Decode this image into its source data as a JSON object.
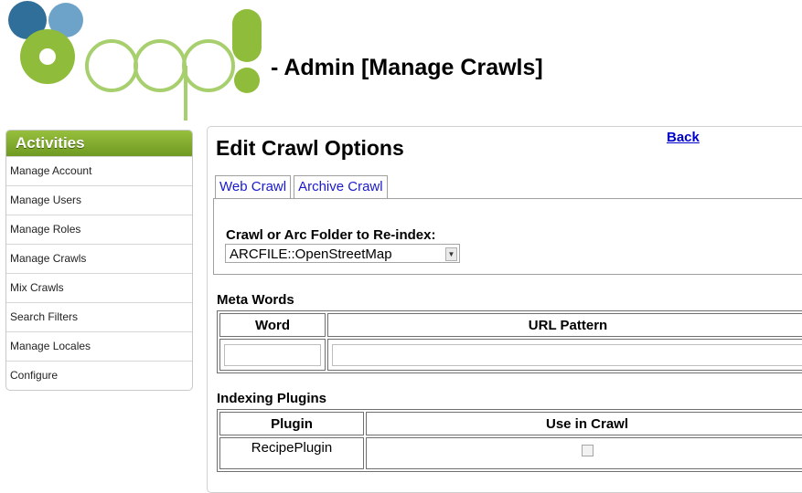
{
  "header": {
    "title": "- Admin [Manage Crawls]",
    "colors": {
      "logo_blue": "#2f6f9a",
      "logo_green": "#8fbc3a",
      "logo_outline": "#a8cf6e"
    }
  },
  "sidebar": {
    "title": "Activities",
    "items": [
      {
        "label": "Manage Account"
      },
      {
        "label": "Manage Users"
      },
      {
        "label": "Manage Roles"
      },
      {
        "label": "Manage Crawls"
      },
      {
        "label": "Mix Crawls"
      },
      {
        "label": "Search Filters"
      },
      {
        "label": "Manage Locales"
      },
      {
        "label": "Configure"
      }
    ]
  },
  "main": {
    "title": "Edit Crawl Options",
    "back_label": "Back",
    "tabs": [
      {
        "label": "Web Crawl"
      },
      {
        "label": "Archive Crawl"
      }
    ],
    "archive": {
      "folder_label": "Crawl or Arc Folder to Re-index:",
      "folder_value": "ARCFILE::OpenStreetMap"
    },
    "meta_words": {
      "title": "Meta Words",
      "columns": [
        "Word",
        "URL Pattern"
      ]
    },
    "indexing_plugins": {
      "title": "Indexing Plugins",
      "columns": [
        "Plugin",
        "Use in Crawl"
      ],
      "rows": [
        {
          "plugin": "RecipePlugin"
        }
      ]
    }
  }
}
